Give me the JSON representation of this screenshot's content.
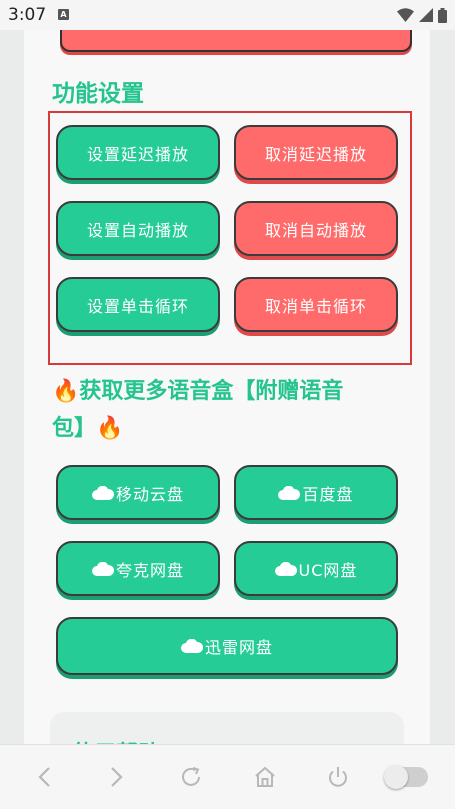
{
  "status": {
    "time": "3:07",
    "notif_icon_label": "A"
  },
  "sections": {
    "settings": {
      "title": "功能设置",
      "buttons": [
        "设置延迟播放",
        "取消延迟播放",
        "设置自动播放",
        "取消自动播放",
        "设置单击循环",
        "取消单击循环"
      ]
    },
    "more": {
      "title_line1": "🔥获取更多语音盒【附赠语音",
      "title_line2": "包】🔥",
      "buttons": [
        "移动云盘",
        "百度盘",
        "夸克网盘",
        "UC网盘",
        "迅雷网盘"
      ]
    },
    "help": {
      "title": "使用帮助"
    }
  },
  "colors": {
    "green": "#25cc96",
    "red": "#ff6b6b",
    "title_green": "#25c48e",
    "box_border": "#d63a3a"
  }
}
